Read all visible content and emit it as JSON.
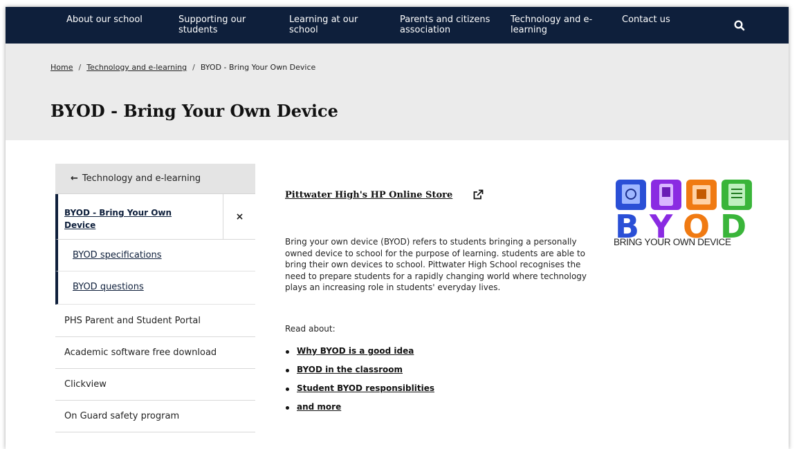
{
  "nav": {
    "items": [
      "About our school",
      "Supporting our\nstudents",
      "Learning at our\nschool",
      "Parents and citizens\nassociation",
      "Technology and e-\nlearning",
      "Contact us"
    ],
    "search_icon": "search-icon"
  },
  "breadcrumb": {
    "home": "Home",
    "sep": "/",
    "section": "Technology and e-learning",
    "current": "BYOD - Bring Your Own Device"
  },
  "page": {
    "title": "BYOD - Bring Your Own Device"
  },
  "sidebar": {
    "back_label": "Technology and e-learning",
    "active_label": "BYOD - Bring Your Own Device",
    "close_glyph": "×",
    "sub_items": [
      "BYOD specifications",
      "BYOD questions"
    ],
    "items": [
      "PHS Parent and Student Portal",
      "Academic software free download",
      "Clickview",
      "On Guard safety program"
    ]
  },
  "main": {
    "store_link": "Pittwater High's HP Online Store",
    "paragraph": "Bring your own device (BYOD) refers to students bringing a personally owned device to school for the purpose of learning. students are able to bring their own devices to school. Pittwater High School recognises the need to prepare students for a rapidly changing world where technology plays an increasing role in students' everyday lives.",
    "read_about": "Read about:",
    "links": [
      "Why BYOD is a good idea",
      "BYOD in the classroom",
      "Student BYOD responsiblities",
      "and more"
    ]
  },
  "logo": {
    "letters": [
      "B",
      "Y",
      "O",
      "D"
    ],
    "caption": "BRING YOUR OWN DEVICE"
  },
  "colors": {
    "nav_bg": "#0e1f3b",
    "band_bg": "#ebebeb",
    "logo_blue": "#2a4fd6",
    "logo_purple": "#8a2be2",
    "logo_orange": "#f07a12",
    "logo_green": "#3ab53a"
  }
}
